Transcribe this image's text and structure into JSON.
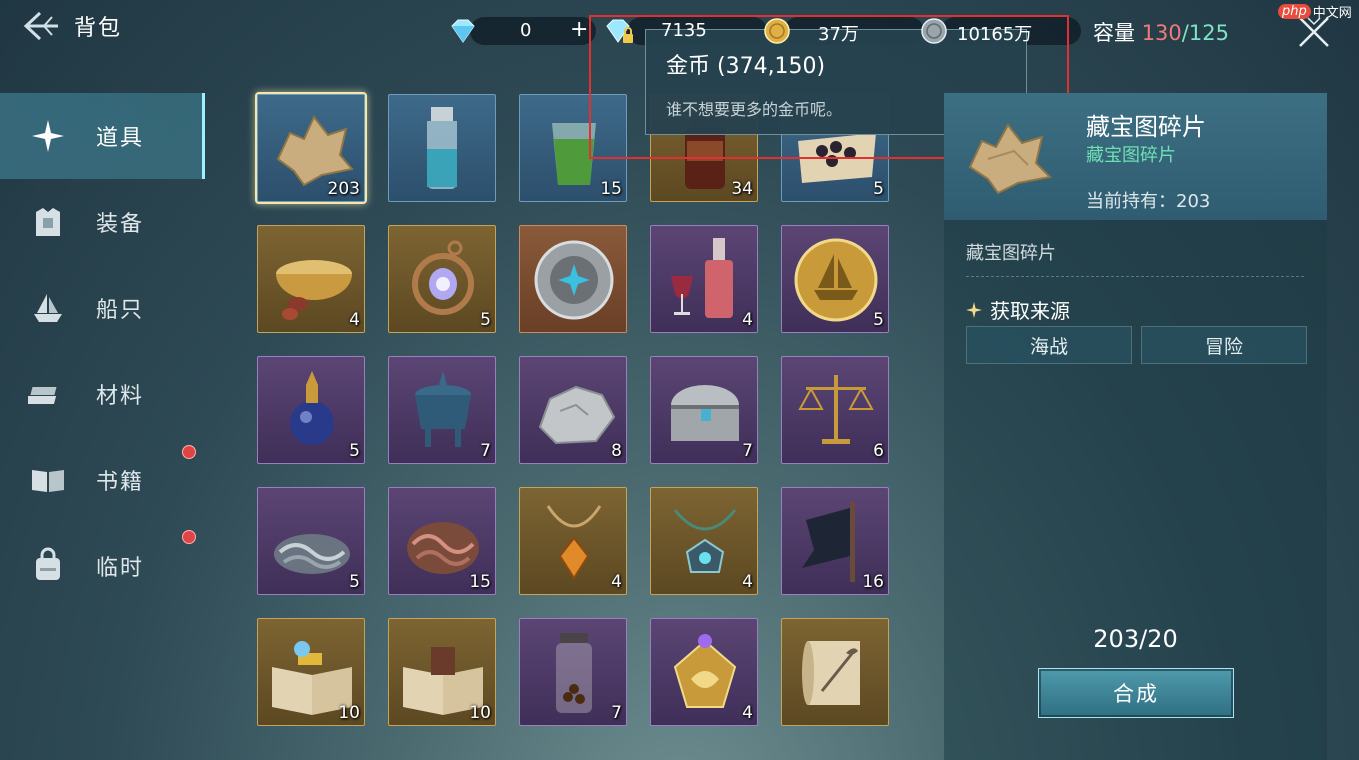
{
  "header": {
    "title": "背包",
    "capacity_label": "容量",
    "capacity_used": "130",
    "capacity_sep": "/",
    "capacity_max": "125"
  },
  "currencies": [
    {
      "name": "diamond-icon",
      "value": "0",
      "plus": "+"
    },
    {
      "name": "locked-diamond-icon",
      "value": "7135"
    },
    {
      "name": "gold-coin-icon",
      "value": "37万"
    },
    {
      "name": "silver-coin-icon",
      "value": "10165万"
    }
  ],
  "tooltip": {
    "title": "金币 (374,150)",
    "desc": "谁不想要更多的金币呢。"
  },
  "sidebar": {
    "items": [
      {
        "label": "道具",
        "icon": "sparkle-icon"
      },
      {
        "label": "装备",
        "icon": "armor-icon"
      },
      {
        "label": "船只",
        "icon": "ship-icon"
      },
      {
        "label": "材料",
        "icon": "materials-icon"
      },
      {
        "label": "书籍",
        "icon": "book-icon"
      },
      {
        "label": "临时",
        "icon": "bag-icon"
      }
    ]
  },
  "grid": {
    "items": [
      {
        "qty": "203",
        "rarity": "blue",
        "icon": "treasure-map-fragment-icon"
      },
      {
        "qty": "",
        "rarity": "blue",
        "icon": "water-bottle-icon"
      },
      {
        "qty": "15",
        "rarity": "blue",
        "icon": "green-drink-icon"
      },
      {
        "qty": "34",
        "rarity": "gold",
        "icon": "wine-bottle-icon"
      },
      {
        "qty": "5",
        "rarity": "blue",
        "icon": "cannonball-map-icon"
      },
      {
        "qty": "4",
        "rarity": "gold",
        "icon": "soup-bowl-icon"
      },
      {
        "qty": "5",
        "rarity": "gold",
        "icon": "amulet-icon"
      },
      {
        "qty": "",
        "rarity": "orange",
        "icon": "silver-medallion-icon"
      },
      {
        "qty": "4",
        "rarity": "purple",
        "icon": "red-wine-icon"
      },
      {
        "qty": "5",
        "rarity": "purple",
        "icon": "ship-coin-icon"
      },
      {
        "qty": "5",
        "rarity": "purple",
        "icon": "perfume-bottle-icon"
      },
      {
        "qty": "7",
        "rarity": "purple",
        "icon": "incense-burner-icon"
      },
      {
        "qty": "8",
        "rarity": "purple",
        "icon": "silver-ore-icon"
      },
      {
        "qty": "7",
        "rarity": "purple",
        "icon": "treasure-chest-icon"
      },
      {
        "qty": "6",
        "rarity": "purple",
        "icon": "balance-scale-icon"
      },
      {
        "qty": "5",
        "rarity": "purple",
        "icon": "iron-chain-icon"
      },
      {
        "qty": "15",
        "rarity": "purple",
        "icon": "copper-chain-icon"
      },
      {
        "qty": "4",
        "rarity": "gold",
        "icon": "amber-necklace-icon"
      },
      {
        "qty": "4",
        "rarity": "gold",
        "icon": "star-pendant-icon"
      },
      {
        "qty": "16",
        "rarity": "purple",
        "icon": "black-flag-icon"
      },
      {
        "qty": "10",
        "rarity": "gold",
        "icon": "gold-ledger-book-icon"
      },
      {
        "qty": "10",
        "rarity": "gold",
        "icon": "open-book-icon"
      },
      {
        "qty": "7",
        "rarity": "purple",
        "icon": "pearl-jar-icon"
      },
      {
        "qty": "4",
        "rarity": "purple",
        "icon": "golden-emblem-icon"
      },
      {
        "qty": "",
        "rarity": "gold",
        "icon": "scroll-quill-icon"
      }
    ]
  },
  "detail": {
    "name": "藏宝图碎片",
    "type": "藏宝图碎片",
    "owned": "当前持有：203",
    "description": "藏宝图碎片",
    "source_title": "获取来源",
    "sources": [
      "海战",
      "冒险"
    ],
    "progress": "203/20",
    "synth_button": "合成"
  },
  "watermark": {
    "php": "php",
    "text": "中文网"
  },
  "colors": {
    "capacity_used": "#f07a7a",
    "capacity_max": "#7fe4c4",
    "type_green": "#6fe0b4",
    "highlight_red": "#e03030"
  }
}
